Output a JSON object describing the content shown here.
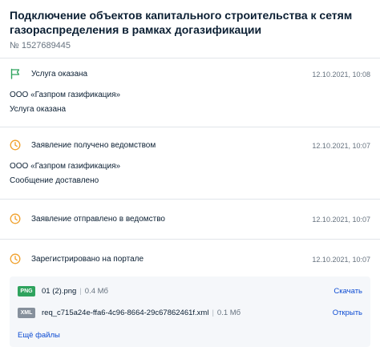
{
  "header": {
    "title": "Подключение объектов капитального строительства к сетям газораспределения в рамках догазификации",
    "number": "№ 1527689445"
  },
  "events": [
    {
      "icon": "flag-icon",
      "icon_color": "#2fa35e",
      "title": "Услуга оказана",
      "date": "12.10.2021, 10:08",
      "lines": [
        "ООО «Газпром газификация»",
        "Услуга оказана"
      ]
    },
    {
      "icon": "clock-icon",
      "icon_color": "#f0a02b",
      "title": "Заявление получено ведомством",
      "date": "12.10.2021, 10:07",
      "lines": [
        "ООО «Газпром газификация»",
        "Сообщение доставлено"
      ]
    },
    {
      "icon": "clock-icon",
      "icon_color": "#f0a02b",
      "title": "Заявление отправлено в ведомство",
      "date": "12.10.2021, 10:07",
      "lines": []
    },
    {
      "icon": "clock-icon",
      "icon_color": "#f0a02b",
      "title": "Зарегистрировано на портале",
      "date": "12.10.2021, 10:07",
      "lines": []
    }
  ],
  "files": [
    {
      "badge": "PNG",
      "name": "01 (2).png",
      "separator": "|",
      "size": "0.4 Мб",
      "action": "Скачать"
    },
    {
      "badge": "XML",
      "name": "req_c715a24e-ffa6-4c96-8664-29c67862461f.xml",
      "separator": "|",
      "size": "0.1 Мб",
      "action": "Открыть"
    }
  ],
  "more_files_label": "Ещё файлы",
  "colors": {
    "accent_link": "#0d4cd3",
    "success": "#2fa35e",
    "pending": "#f0a02b",
    "muted_text": "#66727f"
  }
}
